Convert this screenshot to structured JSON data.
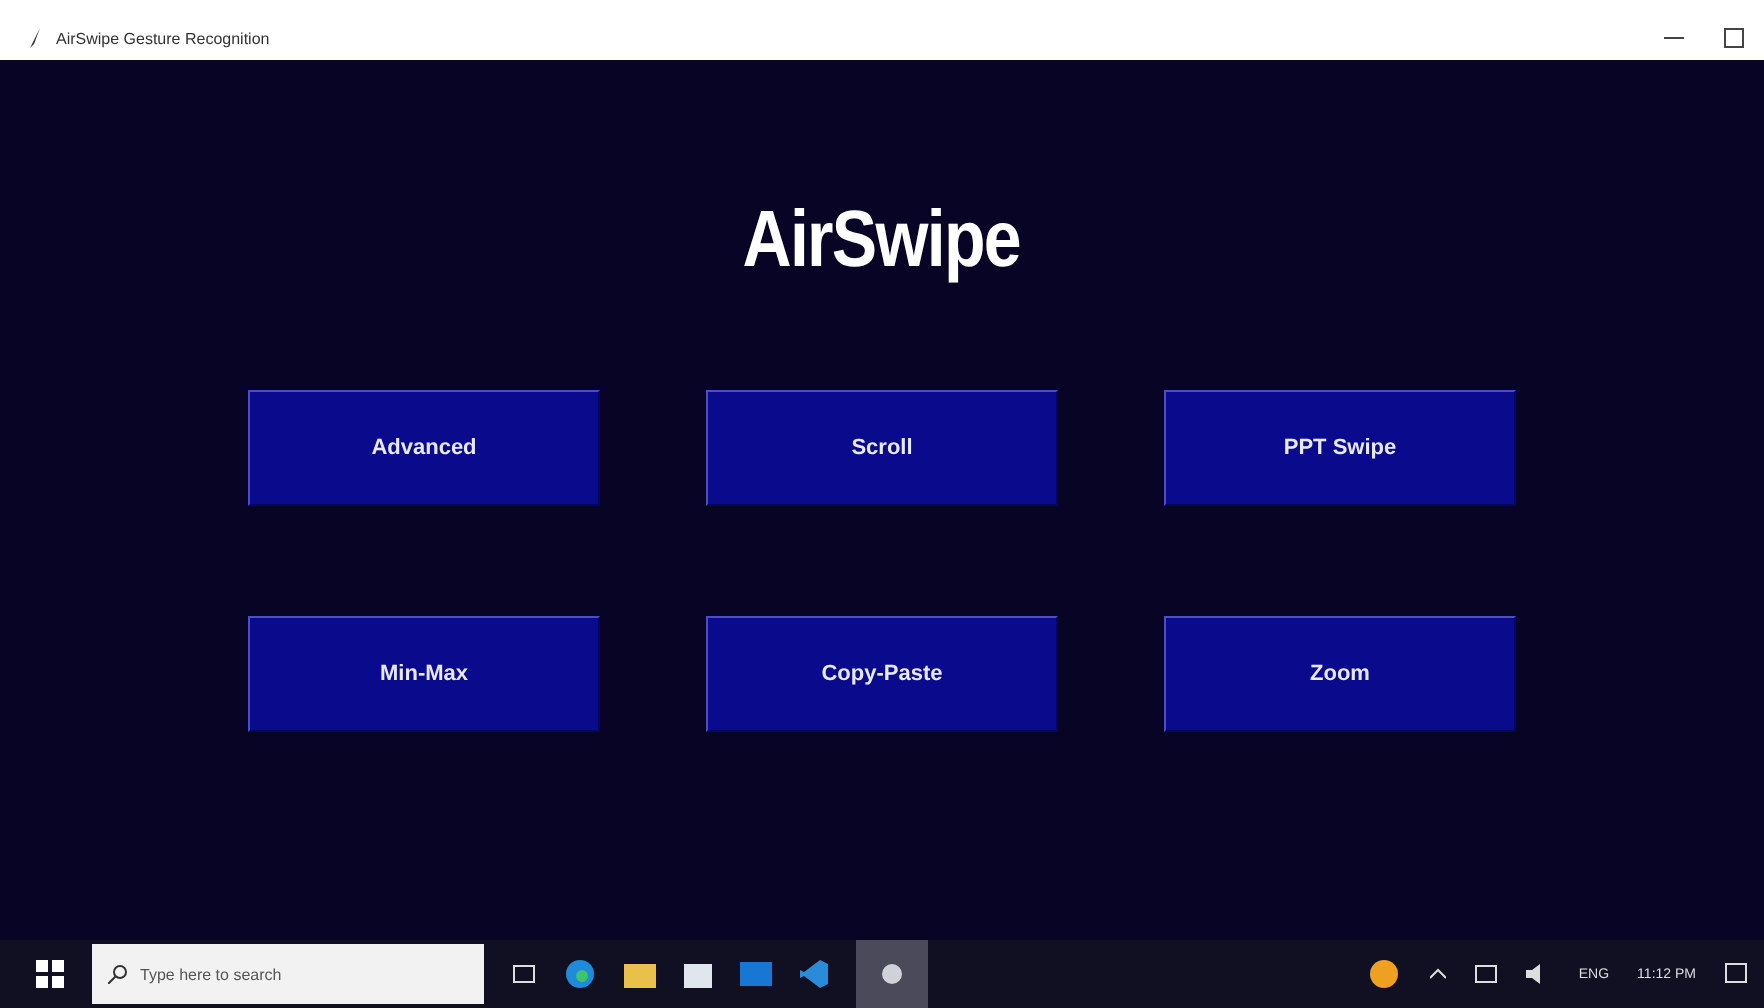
{
  "window": {
    "title": "AirSwipe Gesture Recognition"
  },
  "heading": "AirSwipe",
  "buttons": [
    "Advanced",
    "Scroll",
    "PPT Swipe",
    "Min-Max",
    "Copy-Paste",
    "Zoom"
  ],
  "taskbar": {
    "search_placeholder": "Type here to search",
    "language": "ENG",
    "time": "11:12 PM"
  }
}
